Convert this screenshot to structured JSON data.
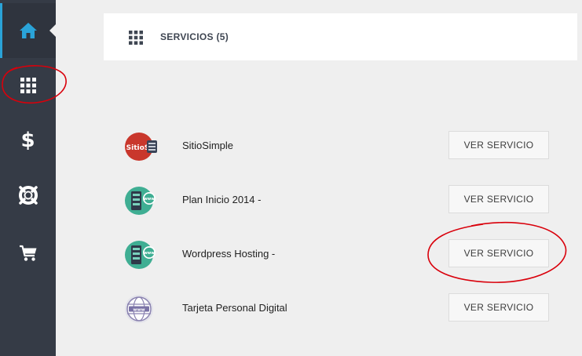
{
  "sidebar": {
    "items": [
      {
        "name": "home",
        "icon": "home-icon",
        "active": true
      },
      {
        "name": "services",
        "icon": "grid-icon",
        "active": false
      },
      {
        "name": "billing",
        "icon": "dollar-icon",
        "glyph": "$",
        "active": false
      },
      {
        "name": "support",
        "icon": "lifebuoy-icon",
        "active": false
      },
      {
        "name": "cart",
        "icon": "cart-icon",
        "active": false
      }
    ]
  },
  "header": {
    "title": "SERVICIOS (5)",
    "icon": "grid-icon"
  },
  "services": [
    {
      "name": "SitioSimple",
      "logo": "sitiosimple-logo",
      "logo_text": "SitioSi",
      "button_label": "VER SERVICIO"
    },
    {
      "name": "Plan Inicio 2014 -",
      "logo": "hosting-server-logo",
      "logo_text": "www",
      "button_label": "VER SERVICIO"
    },
    {
      "name": "Wordpress Hosting -",
      "logo": "hosting-server-logo",
      "logo_text": "www",
      "button_label": "VER SERVICIO"
    },
    {
      "name": "Tarjeta Personal Digital",
      "logo": "www-globe-logo",
      "logo_text": "www",
      "button_label": "VER SERVICIO"
    }
  ],
  "colors": {
    "sidebar_bg": "#353b46",
    "accent": "#2aa3d8",
    "page_bg": "#efefef",
    "annotation_red": "#d9000b",
    "teal": "#3fae93",
    "sitiosimple_red": "#c9372c"
  }
}
